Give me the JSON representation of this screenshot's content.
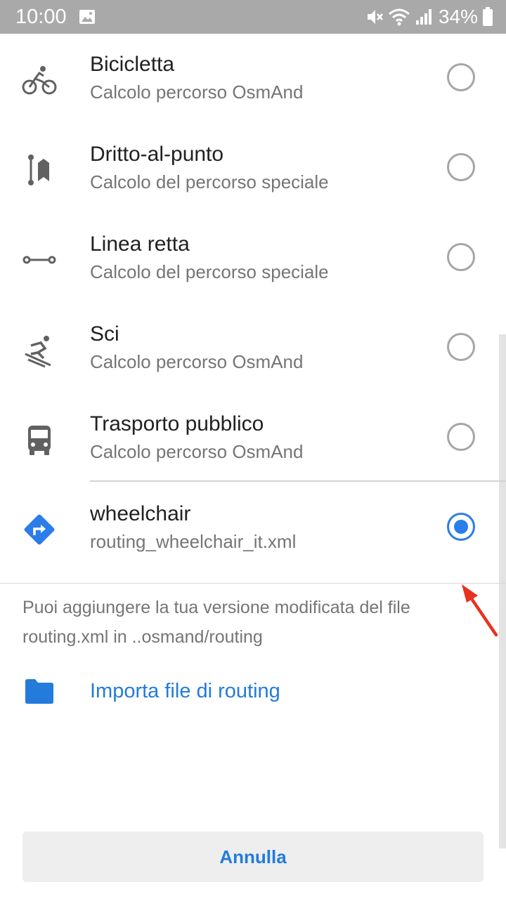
{
  "status_bar": {
    "time": "10:00",
    "battery": "34%",
    "icons": [
      "image-icon",
      "mute-icon",
      "wifi-icon",
      "signal-icon",
      "battery-icon"
    ]
  },
  "routes": [
    {
      "title": "Bicicletta",
      "subtitle": "Calcolo percorso OsmAnd",
      "icon": "bicycle-icon",
      "selected": false
    },
    {
      "title": "Dritto-al-punto",
      "subtitle": "Calcolo del percorso speciale",
      "icon": "direct-to-point-icon",
      "selected": false
    },
    {
      "title": "Linea retta",
      "subtitle": "Calcolo del percorso speciale",
      "icon": "straight-line-icon",
      "selected": false
    },
    {
      "title": "Sci",
      "subtitle": "Calcolo percorso OsmAnd",
      "icon": "skiing-icon",
      "selected": false
    },
    {
      "title": "Trasporto pubblico",
      "subtitle": "Calcolo percorso OsmAnd",
      "icon": "bus-icon",
      "selected": false
    },
    {
      "title": "wheelchair",
      "subtitle": "routing_wheelchair_it.xml",
      "icon": "turn-right-sign-icon",
      "selected": true
    }
  ],
  "hint": "Puoi aggiungere la tua versione modificata del file routing.xml in ..osmand/routing",
  "import": {
    "label": "Importa file di routing",
    "icon": "folder-icon"
  },
  "cancel_label": "Annulla",
  "colors": {
    "accent": "#2b7de9",
    "link": "#237bdb",
    "status_bar": "#a9a9a9",
    "annotation_arrow": "#e8321f"
  }
}
